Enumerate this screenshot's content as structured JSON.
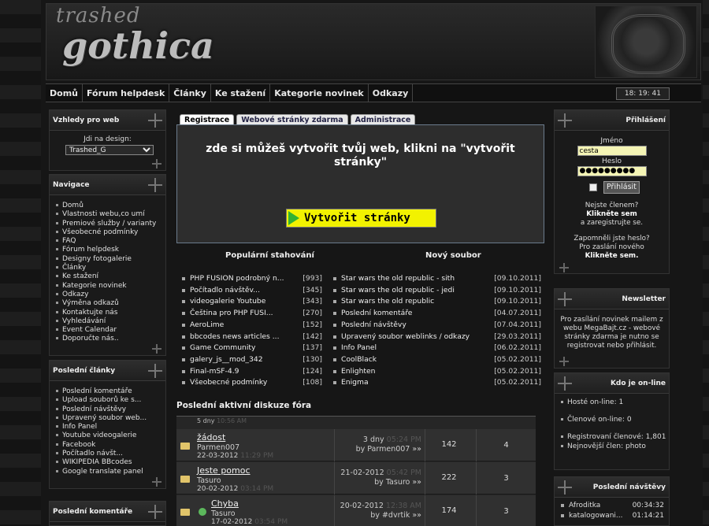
{
  "header": {
    "logo_top": "trashed",
    "logo_main": "gothica",
    "clock": "18: 19: 41"
  },
  "nav": [
    "Domů",
    "Fórum helpdesk",
    "Články",
    "Ke stažení",
    "Kategorie novinek",
    "Odkazy"
  ],
  "left": {
    "vzhledy": {
      "title": "Vzhledy pro web",
      "label": "Jdi na design:",
      "selected": "Trashed_G"
    },
    "navigace": {
      "title": "Navigace",
      "items": [
        "Domů",
        "Vlastnosti webu,co umí",
        "Premiové služby / varianty",
        "Všeobecné podmínky",
        "FAQ",
        "Fórum helpdesk",
        "Designy fotogalerie",
        "Články",
        "Ke stažení",
        "Kategorie novinek",
        "Odkazy",
        "Výměna odkazů",
        "Kontaktujte nás",
        "Vyhledávání",
        "Event Calendar",
        "Doporučte nás.."
      ]
    },
    "clanky": {
      "title": "Poslední články",
      "items": [
        "Poslední komentáře",
        "Upload souborů ke s...",
        "Poslední návštěvy",
        "Upravený soubor web...",
        "Info Panel",
        "Youtube videogalerie",
        "Facebook",
        "Počítadlo návšt...",
        "WIKIPEDIA BBcodes",
        "Google translate panel"
      ]
    },
    "komentare": {
      "title": "Poslední komentáře"
    }
  },
  "center": {
    "tabs": [
      "Registrace",
      "Webové stránky zdarma",
      "Administrace"
    ],
    "reg_title": "zde si můžeš vytvořit tvůj web, klikni na \"vytvořit stránky\"",
    "create_button": "Vytvořit stránky",
    "popular": {
      "title": "Populární stahování",
      "items": [
        {
          "name": "PHP FUSION podrobný n...",
          "count": "[993]"
        },
        {
          "name": "Počítadlo návštěv...",
          "count": "[345]"
        },
        {
          "name": "videogalerie Youtube",
          "count": "[343]"
        },
        {
          "name": "Čeština pro PHP FUSI...",
          "count": "[270]"
        },
        {
          "name": "AeroLime",
          "count": "[152]"
        },
        {
          "name": "bbcodes news articles ...",
          "count": "[142]"
        },
        {
          "name": "Game Community",
          "count": "[137]"
        },
        {
          "name": "galery_js__mod_342",
          "count": "[130]"
        },
        {
          "name": "Final-mSF-4.9",
          "count": "[124]"
        },
        {
          "name": "Všeobecné podmínky",
          "count": "[108]"
        }
      ]
    },
    "newfile": {
      "title": "Nový soubor",
      "items": [
        {
          "name": "Star wars the old republic - sith",
          "date": "[09.10.2011]"
        },
        {
          "name": "Star wars the old republic - jedi",
          "date": "[09.10.2011]"
        },
        {
          "name": "Star wars the old republic",
          "date": "[09.10.2011]"
        },
        {
          "name": "Poslední komentáře",
          "date": "[04.07.2011]"
        },
        {
          "name": "Poslední návštěvy",
          "date": "[07.04.2011]"
        },
        {
          "name": "Upravený soubor weblinks / odkazy",
          "date": "[29.03.2011]"
        },
        {
          "name": "Info Panel",
          "date": "[06.02.2011]"
        },
        {
          "name": "CoolBlack",
          "date": "[05.02.2011]"
        },
        {
          "name": "Enlighten",
          "date": "[05.02.2011]"
        },
        {
          "name": "Enigma",
          "date": "[05.02.2011]"
        }
      ]
    },
    "forum": {
      "title": "Poslední aktivní diskuze fóra",
      "partial_top": "5 dny",
      "partial_top_ghost": "10:56 AM",
      "rows": [
        {
          "title": "žádost",
          "author": "Parmen007",
          "date": "22-03-2012",
          "date_ghost": "11:29 PM",
          "last_line1": "3 dny",
          "last_ghost": "05:24 PM",
          "last_by": "by Parmen007 »»",
          "posts": "142",
          "replies": "4"
        },
        {
          "title": "Jeste pomoc",
          "author": "Tasuro",
          "date": "20-02-2012",
          "date_ghost": "03:14 PM",
          "last_line1": "21-02-2012",
          "last_ghost": "05:42 PM",
          "last_by": "by Tasuro »»",
          "posts": "222",
          "replies": "3"
        },
        {
          "title": "Chyba",
          "author": "Tasuro",
          "date": "17-02-2012",
          "date_ghost": "03:54 PM",
          "last_line1": "20-02-2012",
          "last_ghost": "12:38 AM",
          "last_by": "by #dvrtik »»",
          "posts": "174",
          "replies": "3"
        }
      ]
    }
  },
  "right": {
    "login": {
      "title": "Přihlášení",
      "jmeno_label": "Jméno",
      "jmeno_value": "cesta",
      "heslo_label": "Heslo",
      "heslo_value": "●●●●●●●●●",
      "button": "Přihlásit",
      "not_member": "Nejste členem?",
      "register_link": "Klikněte sem",
      "register_tail": "a zaregistrujte se.",
      "forgot": "Zapomněli jste heslo?",
      "forgot2": "Pro zaslání nového",
      "forgot_link": "Klikněte sem."
    },
    "newsletter": {
      "title": "Newsletter",
      "text": "Pro zasílání novinek mailem z webu MegaBajt.cz - webové stránky zdarma je nutno se registrovat nebo přihlásit."
    },
    "online": {
      "title": "Kdo je on-line",
      "items": [
        "Hosté on-line: 1",
        "Členové on-line: 0",
        "Registrovaní členové: 1,801",
        "Nejnovější člen: photo"
      ]
    },
    "visits": {
      "title": "Poslední návštěvy",
      "items": [
        {
          "name": "Afroditka",
          "time": "00:34:32"
        },
        {
          "name": "katalogowani...",
          "time": "01:14:21"
        }
      ]
    }
  }
}
